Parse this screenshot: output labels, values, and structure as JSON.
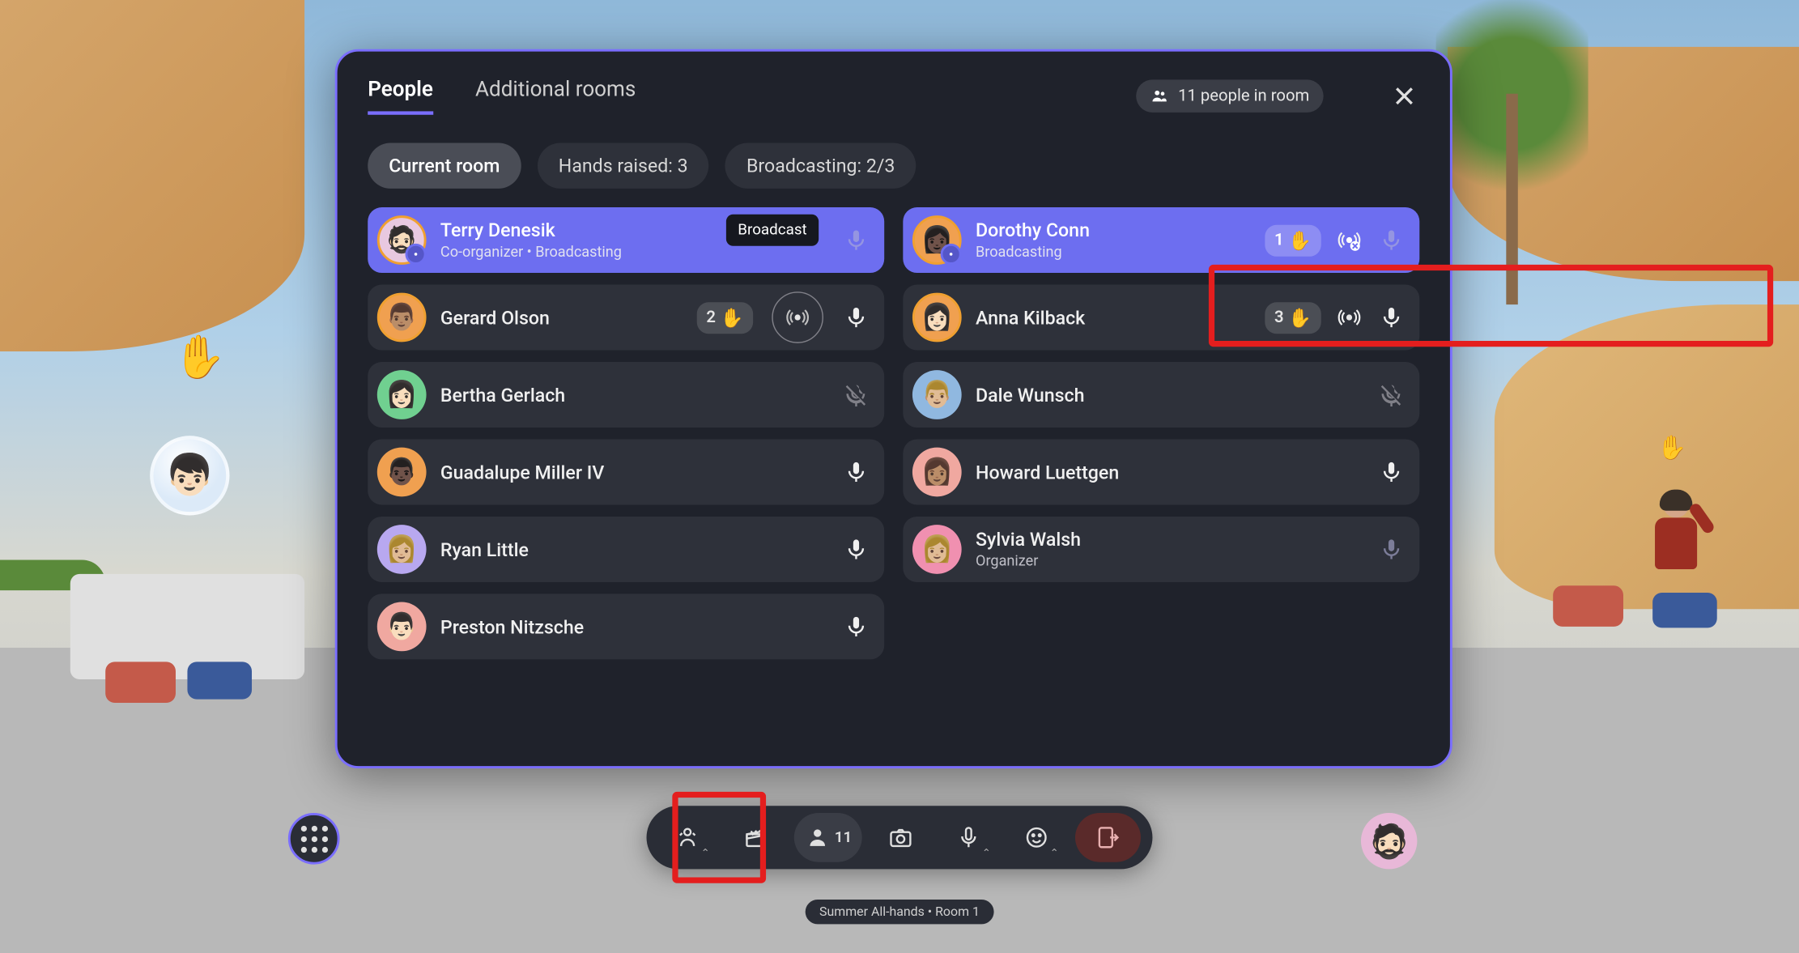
{
  "tabs": {
    "people": "People",
    "additional_rooms": "Additional rooms"
  },
  "room_badge": "11 people in room",
  "filters": {
    "current_room": "Current room",
    "hands_raised": "Hands raised: 3",
    "broadcasting": "Broadcasting: 2/3"
  },
  "tooltip_broadcast": "Broadcast",
  "participants_left": [
    {
      "name": "Terry Denesik",
      "subtitle": "Co-organizer • Broadcasting",
      "broadcast": true,
      "ring": true,
      "avatar_bg": "#e8c8e0",
      "emoji": "🧔🏻",
      "hand": null,
      "mic": "dim",
      "broadcast_icon": false,
      "sub_badge": true
    },
    {
      "name": "Gerard Olson",
      "subtitle": "",
      "broadcast": false,
      "ring": true,
      "avatar_bg": "#f0a050",
      "emoji": "👨🏽",
      "hand": "2",
      "mic": "on",
      "broadcast_circle": true
    },
    {
      "name": "Bertha Gerlach",
      "subtitle": "",
      "broadcast": false,
      "ring": false,
      "avatar_bg": "#70d090",
      "emoji": "👩🏻",
      "hand": null,
      "mic": "muted"
    },
    {
      "name": "Guadalupe Miller IV",
      "subtitle": "",
      "broadcast": false,
      "ring": false,
      "avatar_bg": "#f0a050",
      "emoji": "👨🏿",
      "hand": null,
      "mic": "on"
    },
    {
      "name": "Ryan Little",
      "subtitle": "",
      "broadcast": false,
      "ring": false,
      "avatar_bg": "#b8a8f0",
      "emoji": "👩🏼",
      "hand": null,
      "mic": "on"
    },
    {
      "name": "Preston Nitzsche",
      "subtitle": "",
      "broadcast": false,
      "ring": false,
      "avatar_bg": "#f0a8a0",
      "emoji": "👨🏻",
      "hand": null,
      "mic": "on"
    }
  ],
  "participants_right": [
    {
      "name": "Dorothy Conn",
      "subtitle": "Broadcasting",
      "broadcast": true,
      "ring": true,
      "avatar_bg": "#f0a050",
      "emoji": "👩🏿",
      "hand": "1",
      "mic": "dim",
      "broadcast_icon": true,
      "broadcast_icon_x": true,
      "sub_badge": true
    },
    {
      "name": "Anna Kilback",
      "subtitle": "",
      "broadcast": false,
      "ring": true,
      "avatar_bg": "#f0a050",
      "emoji": "👩🏻",
      "hand": "3",
      "mic": "on",
      "broadcast_icon": true
    },
    {
      "name": "Dale Wunsch",
      "subtitle": "",
      "broadcast": false,
      "ring": false,
      "avatar_bg": "#90b8e0",
      "emoji": "👨🏼",
      "hand": null,
      "mic": "muted"
    },
    {
      "name": "Howard Luettgen",
      "subtitle": "",
      "broadcast": false,
      "ring": false,
      "avatar_bg": "#f0a8a0",
      "emoji": "👩🏽",
      "hand": null,
      "mic": "on"
    },
    {
      "name": "Sylvia Walsh",
      "subtitle": "Organizer",
      "broadcast": false,
      "ring": false,
      "avatar_bg": "#f090b0",
      "emoji": "👩🏼",
      "hand": null,
      "mic": "dim"
    }
  ],
  "menubar_people_count": "11",
  "room_label": "Summer All-hands • Room 1"
}
